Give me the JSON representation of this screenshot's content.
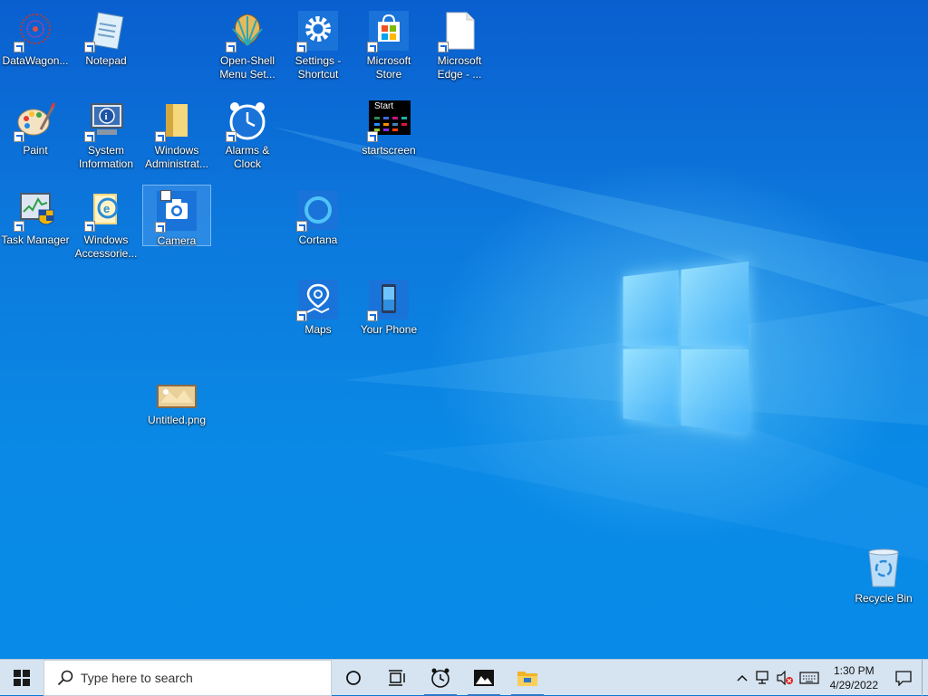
{
  "desktop": {
    "icons": [
      {
        "label": "DataWagon...",
        "icon": "datawagon-icon"
      },
      {
        "label": "Notepad",
        "icon": "notepad-icon"
      },
      {
        "label": "Open-Shell\nMenu Set...",
        "icon": "open-shell-icon"
      },
      {
        "label": "Settings -\nShortcut",
        "icon": "gear-icon"
      },
      {
        "label": "Microsoft\nStore",
        "icon": "store-icon"
      },
      {
        "label": "Microsoft\nEdge - ...",
        "icon": "file-icon"
      },
      {
        "label": "Paint",
        "icon": "paint-palette-icon"
      },
      {
        "label": "System\nInformation",
        "icon": "system-info-icon"
      },
      {
        "label": "Windows\nAdministrat...",
        "icon": "folder-icon"
      },
      {
        "label": "Alarms &\nClock",
        "icon": "alarm-clock-icon"
      },
      {
        "label": "startscreen",
        "icon": "start-screen-icon",
        "tile_text": "Start"
      },
      {
        "label": "Task Manager",
        "icon": "task-manager-icon"
      },
      {
        "label": "Windows\nAccessorie...",
        "icon": "accessories-icon"
      },
      {
        "label": "Camera",
        "icon": "camera-icon",
        "selected": true
      },
      {
        "label": "Cortana",
        "icon": "cortana-icon"
      },
      {
        "label": "Maps",
        "icon": "map-pin-icon"
      },
      {
        "label": "Your Phone",
        "icon": "phone-icon"
      },
      {
        "label": "Untitled.png",
        "icon": "image-file-icon"
      },
      {
        "label": "Recycle Bin",
        "icon": "recycle-bin-icon"
      }
    ]
  },
  "taskbar": {
    "search_placeholder": "Type here to search",
    "clock_time": "1:30 PM",
    "clock_date": "4/29/2022",
    "pinned": [
      "alarm-clock-icon",
      "photos-icon",
      "file-explorer-icon"
    ]
  },
  "colors": {
    "accent": "#1a73d9",
    "taskbar": "#d6e3f0"
  }
}
